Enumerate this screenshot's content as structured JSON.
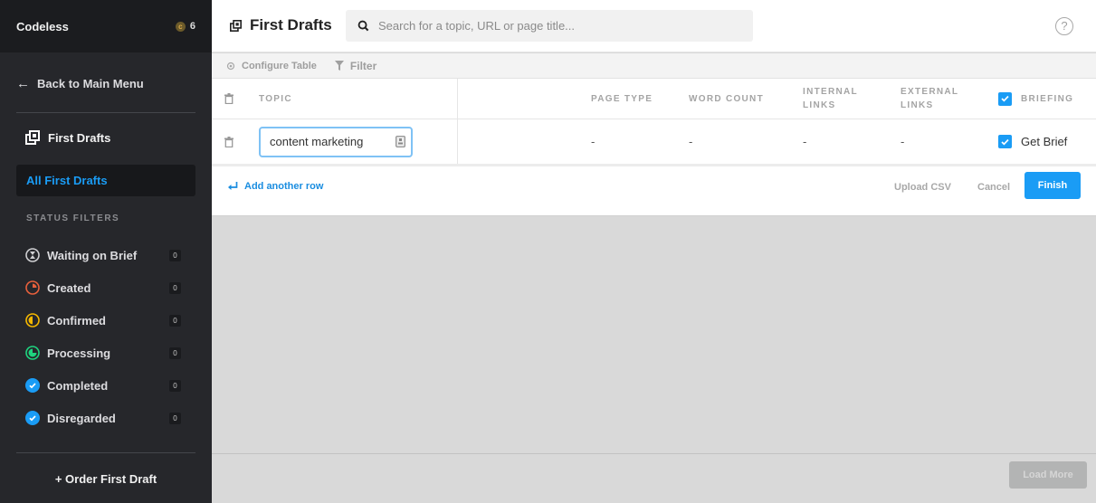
{
  "sidebar": {
    "brand": "Codeless",
    "credits": "6",
    "back_label": "Back to Main Menu",
    "section_title": "First Drafts",
    "active_item": "All First Drafts",
    "status_heading": "STATUS FILTERS",
    "status_items": [
      {
        "label": "Waiting on Brief",
        "count": "0",
        "icon": "hourglass-icon",
        "color": "#cfcfd2"
      },
      {
        "label": "Created",
        "count": "0",
        "icon": "pie-quarter-icon",
        "color": "#e8603c"
      },
      {
        "label": "Confirmed",
        "count": "0",
        "icon": "pie-half-icon",
        "color": "#f5b800"
      },
      {
        "label": "Processing",
        "count": "0",
        "icon": "pie-three-quarter-icon",
        "color": "#1ed47f"
      },
      {
        "label": "Completed",
        "count": "0",
        "icon": "check-circle-icon",
        "color": "#1a9cf5"
      },
      {
        "label": "Disregarded",
        "count": "0",
        "icon": "check-circle-icon",
        "color": "#1a9cf5"
      }
    ],
    "order_label": "+ Order First Draft"
  },
  "header": {
    "title": "First Drafts",
    "search_placeholder": "Search for a topic, URL or page title...",
    "search_value": "",
    "help_label": "?"
  },
  "toolbar": {
    "configure_label": "Configure Table",
    "filter_label": "Filter"
  },
  "table": {
    "columns": {
      "topic": "TOPIC",
      "page_type": "PAGE TYPE",
      "word_count": "WORD COUNT",
      "internal_links_1": "INTERNAL",
      "internal_links_2": "LINKS",
      "external_links_1": "EXTERNAL",
      "external_links_2": "LINKS",
      "briefing": "BRIEFING"
    },
    "briefing_header_checked": true,
    "rows": [
      {
        "topic": "content marketing",
        "page_type": "-",
        "word_count": "-",
        "internal_links": "-",
        "external_links": "-",
        "briefing_checked": true,
        "briefing_label": "Get Brief"
      }
    ]
  },
  "actions": {
    "add_row": "Add another row",
    "upload_csv": "Upload CSV",
    "cancel": "Cancel",
    "finish": "Finish"
  },
  "footer": {
    "load_more": "Load More"
  },
  "colors": {
    "accent": "#1a9cf5",
    "sidebar_bg": "#26272b"
  }
}
